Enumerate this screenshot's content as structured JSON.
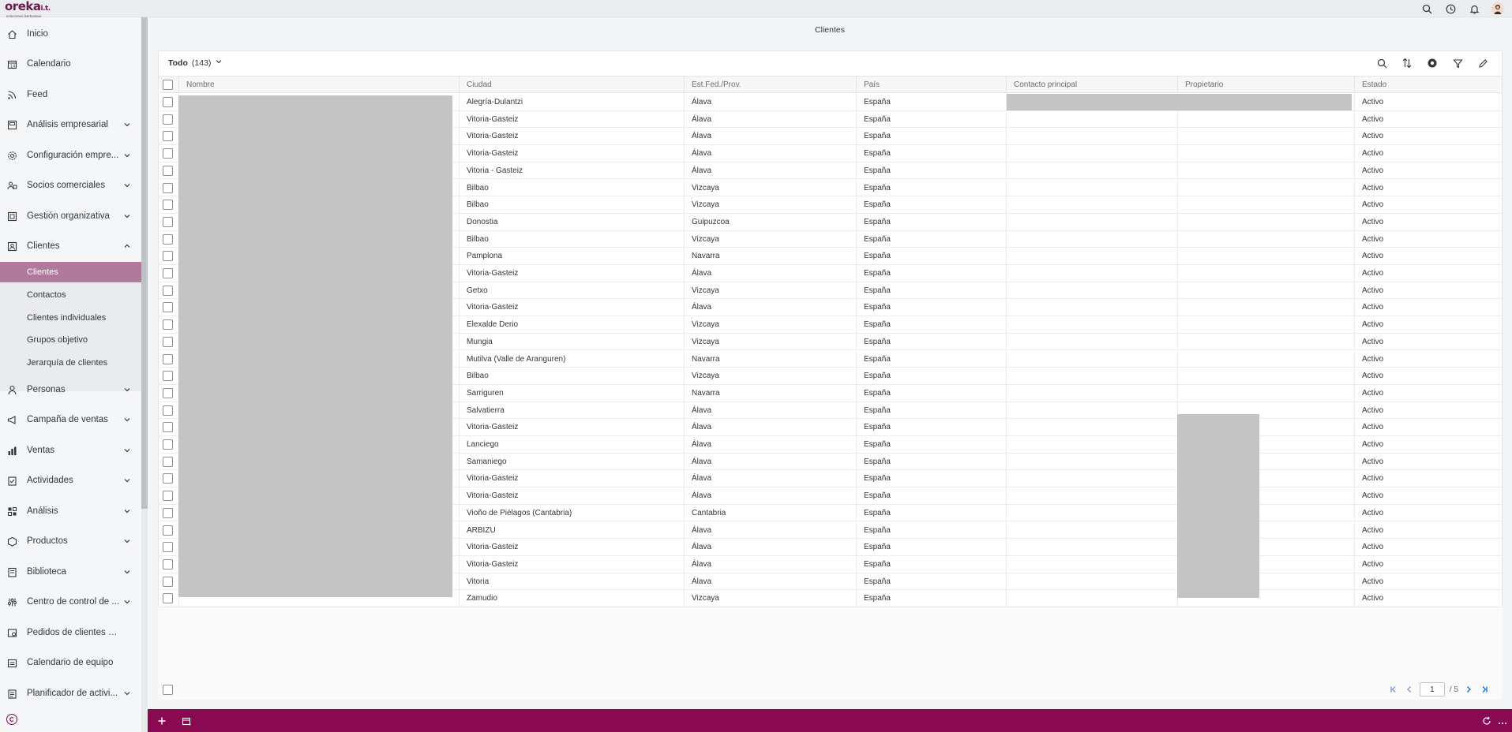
{
  "brand": {
    "name": "oreka",
    "suffix": "i.t.",
    "tagline": "soluciones ikerbasque"
  },
  "colors": {
    "accent": "#8a0a52",
    "active_nav": "#b07a9c"
  },
  "sidebar": {
    "items": [
      {
        "label": "Inicio",
        "icon": "home-icon"
      },
      {
        "label": "Calendario",
        "icon": "calendar-icon"
      },
      {
        "label": "Feed",
        "icon": "feed-icon"
      },
      {
        "label": "Análisis empresarial",
        "icon": "business-analysis-icon"
      },
      {
        "label": "Configuración empre...",
        "icon": "config-icon"
      },
      {
        "label": "Socios comerciales",
        "icon": "partners-icon"
      },
      {
        "label": "Gestión organizativa",
        "icon": "org-icon"
      },
      {
        "label": "Clientes",
        "icon": "customers-icon"
      },
      {
        "label": "Personas",
        "icon": "person-icon"
      },
      {
        "label": "Campaña de ventas",
        "icon": "megaphone-icon"
      },
      {
        "label": "Ventas",
        "icon": "sales-icon"
      },
      {
        "label": "Actividades",
        "icon": "activities-icon"
      },
      {
        "label": "Análisis",
        "icon": "analysis-icon"
      },
      {
        "label": "Productos",
        "icon": "product-icon"
      },
      {
        "label": "Biblioteca",
        "icon": "library-icon"
      },
      {
        "label": "Centro de control de ...",
        "icon": "control-icon"
      },
      {
        "label": "Pedidos de clientes ECC",
        "icon": "orders-icon"
      },
      {
        "label": "Calendario de equipo",
        "icon": "team-calendar-icon"
      },
      {
        "label": "Planificador de activi...",
        "icon": "planner-icon"
      }
    ],
    "subitems": [
      "Clientes",
      "Contactos",
      "Clientes individuales",
      "Grupos objetivo",
      "Jerarquía de clientes"
    ]
  },
  "page": {
    "title": "Clientes"
  },
  "view": {
    "name": "Todo",
    "count": "(143)"
  },
  "table": {
    "columns": [
      "Nombre",
      "Ciudad",
      "Est.Fed./Prov.",
      "País",
      "Contacto principal",
      "Propietario",
      "Estado"
    ],
    "rows": [
      [
        "Alegría-Dulantzi",
        "Álava",
        "España",
        "Activo"
      ],
      [
        "Vitoria-Gasteiz",
        "Álava",
        "España",
        "Activo"
      ],
      [
        "Vitoria-Gasteiz",
        "Álava",
        "España",
        "Activo"
      ],
      [
        "Vitoria-Gasteiz",
        "Álava",
        "España",
        "Activo"
      ],
      [
        "Vitoria - Gasteiz",
        "Álava",
        "España",
        "Activo"
      ],
      [
        "Bilbao",
        "Vizcaya",
        "España",
        "Activo"
      ],
      [
        "Bilbao",
        "Vizcaya",
        "España",
        "Activo"
      ],
      [
        "Donostia",
        "Guipuzcoa",
        "España",
        "Activo"
      ],
      [
        "Bilbao",
        "Vizcaya",
        "España",
        "Activo"
      ],
      [
        "Pamplona",
        "Navarra",
        "España",
        "Activo"
      ],
      [
        "Vitoria-Gasteiz",
        "Álava",
        "España",
        "Activo"
      ],
      [
        "Getxo",
        "Vizcaya",
        "España",
        "Activo"
      ],
      [
        "Vitoria-Gasteiz",
        "Álava",
        "España",
        "Activo"
      ],
      [
        "Elexalde Derio",
        "Vizcaya",
        "España",
        "Activo"
      ],
      [
        "Mungia",
        "Vizcaya",
        "España",
        "Activo"
      ],
      [
        "Mutilva (Valle de Aranguren)",
        "Navarra",
        "España",
        "Activo"
      ],
      [
        "Bilbao",
        "Vizcaya",
        "España",
        "Activo"
      ],
      [
        "Sarriguren",
        "Navarra",
        "España",
        "Activo"
      ],
      [
        "Salvatierra",
        "Álava",
        "España",
        "Activo"
      ],
      [
        "Vitoria-Gasteiz",
        "Álava",
        "España",
        "Activo"
      ],
      [
        "Lanciego",
        "Álava",
        "España",
        "Activo"
      ],
      [
        "Samaniego",
        "Álava",
        "España",
        "Activo"
      ],
      [
        "Vitoria-Gasteiz",
        "Álava",
        "España",
        "Activo"
      ],
      [
        "Vitoria-Gasteiz",
        "Álava",
        "España",
        "Activo"
      ],
      [
        "Vioño de Piélagos (Cantabria)",
        "Cantabria",
        "España",
        "Activo"
      ],
      [
        "ARBIZU",
        "Álava",
        "España",
        "Activo"
      ],
      [
        "Vitoria-Gasteiz",
        "Álava",
        "España",
        "Activo"
      ],
      [
        "Vitoria-Gasteiz",
        "Álava",
        "España",
        "Activo"
      ],
      [
        "Vitoria",
        "Álava",
        "España",
        "Activo"
      ],
      [
        "Zamudio",
        "Vizcaya",
        "España",
        "Activo"
      ]
    ]
  },
  "pagination": {
    "current": "1",
    "total": "/ 5"
  }
}
